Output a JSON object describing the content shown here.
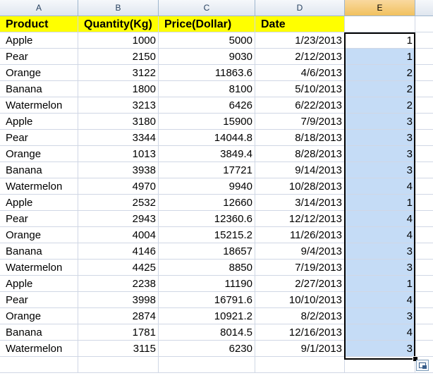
{
  "columns": [
    "A",
    "B",
    "C",
    "D",
    "E"
  ],
  "headers": {
    "product": "Product",
    "quantity": "Quantity(Kg)",
    "price": "Price(Dollar)",
    "date": "Date"
  },
  "rows": [
    {
      "product": "Apple",
      "quantity": "1000",
      "price": "5000",
      "date": "1/23/2013",
      "e": "1"
    },
    {
      "product": "Pear",
      "quantity": "2150",
      "price": "9030",
      "date": "2/12/2013",
      "e": "1"
    },
    {
      "product": "Orange",
      "quantity": "3122",
      "price": "11863.6",
      "date": "4/6/2013",
      "e": "2"
    },
    {
      "product": "Banana",
      "quantity": "1800",
      "price": "8100",
      "date": "5/10/2013",
      "e": "2"
    },
    {
      "product": "Watermelon",
      "quantity": "3213",
      "price": "6426",
      "date": "6/22/2013",
      "e": "2"
    },
    {
      "product": "Apple",
      "quantity": "3180",
      "price": "15900",
      "date": "7/9/2013",
      "e": "3"
    },
    {
      "product": "Pear",
      "quantity": "3344",
      "price": "14044.8",
      "date": "8/18/2013",
      "e": "3"
    },
    {
      "product": "Orange",
      "quantity": "1013",
      "price": "3849.4",
      "date": "8/28/2013",
      "e": "3"
    },
    {
      "product": "Banana",
      "quantity": "3938",
      "price": "17721",
      "date": "9/14/2013",
      "e": "3"
    },
    {
      "product": "Watermelon",
      "quantity": "4970",
      "price": "9940",
      "date": "10/28/2013",
      "e": "4"
    },
    {
      "product": "Apple",
      "quantity": "2532",
      "price": "12660",
      "date": "3/14/2013",
      "e": "1"
    },
    {
      "product": "Pear",
      "quantity": "2943",
      "price": "12360.6",
      "date": "12/12/2013",
      "e": "4"
    },
    {
      "product": "Orange",
      "quantity": "4004",
      "price": "15215.2",
      "date": "11/26/2013",
      "e": "4"
    },
    {
      "product": "Banana",
      "quantity": "4146",
      "price": "18657",
      "date": "9/4/2013",
      "e": "3"
    },
    {
      "product": "Watermelon",
      "quantity": "4425",
      "price": "8850",
      "date": "7/19/2013",
      "e": "3"
    },
    {
      "product": "Apple",
      "quantity": "2238",
      "price": "11190",
      "date": "2/27/2013",
      "e": "1"
    },
    {
      "product": "Pear",
      "quantity": "3998",
      "price": "16791.6",
      "date": "10/10/2013",
      "e": "4"
    },
    {
      "product": "Orange",
      "quantity": "2874",
      "price": "10921.2",
      "date": "8/2/2013",
      "e": "3"
    },
    {
      "product": "Banana",
      "quantity": "1781",
      "price": "8014.5",
      "date": "12/16/2013",
      "e": "4"
    },
    {
      "product": "Watermelon",
      "quantity": "3115",
      "price": "6230",
      "date": "9/1/2013",
      "e": "3"
    }
  ],
  "colors": {
    "header_fill": "#ffff00",
    "selection_fill": "#c5dcf6",
    "gridline": "#d0d7e5",
    "selected_column_header": "#f1c15f"
  },
  "icons": {
    "paste_options": "paste-options-icon",
    "fill_handle": "fill-handle"
  }
}
